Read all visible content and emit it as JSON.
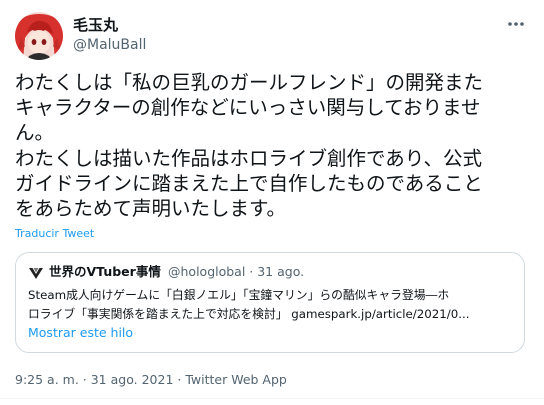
{
  "author": {
    "name": "毛玉丸",
    "handle": "@MaluBall",
    "avatar_icon": "avatar-red-hair-character"
  },
  "menu": {
    "icon": "more-horizontal-icon"
  },
  "tweet": {
    "lines": [
      "わたくしは「私の巨乳のガールフレンド」の開発また",
      "キャラクターの創作などにいっさい関与しておりませ",
      "ん。",
      "わたくしは描いた作品はホロライブ創作であり、公式",
      "ガイドラインに踏まえた上で自作したものであること",
      "をあらためて声明いたします。"
    ]
  },
  "translate_label": "Traducir Tweet",
  "quote": {
    "name": "世界のVTuber事情",
    "handle_time": "@hologlobal · 31 ago.",
    "text_line1": "Steam成人向けゲームに「白銀ノエル」「宝鐘マリン」らの酷似キャラ登場―ホ",
    "text_line2_prefix": "ロライブ「事実関係を踏まえた上で対応を検討」 ",
    "text_line2_link": "gamespark.jp/article/2021/0...",
    "show_thread": "Mostrar este hilo",
    "avatar_icon": "vtuber-logo-icon"
  },
  "meta": {
    "time": "9:25 a. m.",
    "date": "31 ago. 2021",
    "client": "Twitter Web App",
    "separator": " · "
  },
  "colors": {
    "text": "#0f1419",
    "secondary": "#536471",
    "link": "#1d9bf0",
    "border": "#cfd9de"
  }
}
